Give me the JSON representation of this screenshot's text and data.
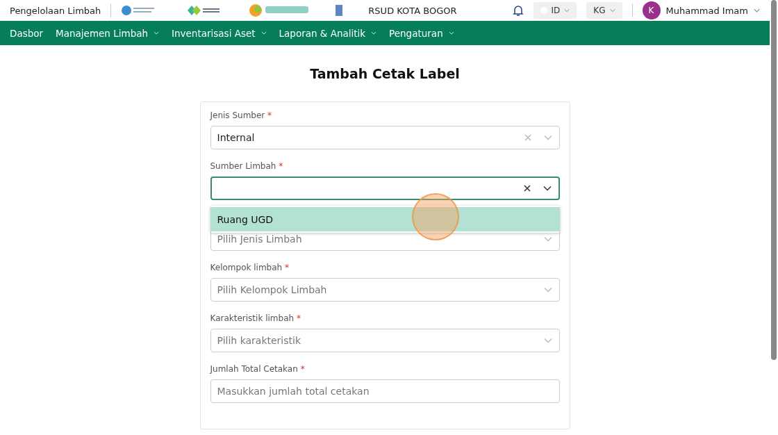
{
  "header": {
    "app_name": "Pengelolaan Limbah",
    "hospital": "RSUD KOTA BOGOR",
    "language": "ID",
    "unit": "KG",
    "user": {
      "initial": "K",
      "name": "Muhammad Imam"
    }
  },
  "nav": [
    {
      "label": "Dasbor",
      "has_menu": false
    },
    {
      "label": "Manajemen Limbah",
      "has_menu": true
    },
    {
      "label": "Inventarisasi Aset",
      "has_menu": true
    },
    {
      "label": "Laporan & Analitik",
      "has_menu": true
    },
    {
      "label": "Pengaturan",
      "has_menu": true
    }
  ],
  "page_title": "Tambah Cetak Label",
  "form": {
    "fields": [
      {
        "kind": "select",
        "label": "Jenis Sumber",
        "required_mark": "*",
        "value": "Internal",
        "clearable": true,
        "focused": false
      },
      {
        "kind": "select",
        "label": "Sumber Limbah",
        "required_mark": "*",
        "clearable": true,
        "focused": true,
        "options": [
          {
            "label": "Ruang UGD",
            "selected": true
          }
        ]
      },
      {
        "kind": "select",
        "placeholder": "Pilih Jenis Limbah",
        "focused": false
      },
      {
        "kind": "select",
        "label": "Kelompok limbah",
        "required_mark": "*",
        "placeholder": "Pilih Kelompok Limbah",
        "focused": false
      },
      {
        "kind": "select",
        "label": "Karakteristik limbah",
        "required_mark": "*",
        "placeholder": "Pilih karakteristik",
        "focused": false
      },
      {
        "kind": "input",
        "label": "Jumlah Total Cetakan",
        "required_mark": "*",
        "placeholder": "Masukkan jumlah total cetakan",
        "focused": false
      }
    ]
  }
}
